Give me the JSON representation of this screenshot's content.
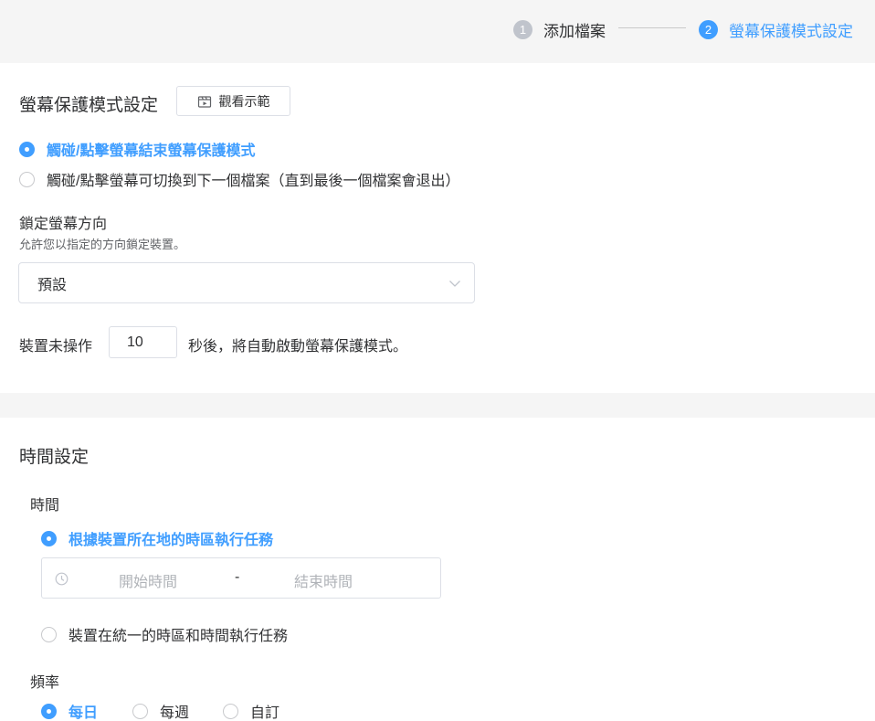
{
  "steps": [
    {
      "num": "1",
      "label": "添加檔案",
      "state": "done"
    },
    {
      "num": "2",
      "label": "螢幕保護模式設定",
      "state": "active"
    }
  ],
  "screensaver": {
    "title": "螢幕保護模式設定",
    "demo_button": "觀看示範",
    "options": [
      {
        "label": "觸碰/點擊螢幕結束螢幕保護模式",
        "selected": true
      },
      {
        "label": "觸碰/點擊螢幕可切換到下一個檔案（直到最後一個檔案會退出）",
        "selected": false
      }
    ],
    "lock": {
      "title": "鎖定螢幕方向",
      "subtitle": "允許您以指定的方向鎖定裝置。",
      "selected": "預設"
    },
    "idle": {
      "prefix": "裝置未操作",
      "value": "10",
      "suffix": "秒後，將自動啟動螢幕保護模式。"
    }
  },
  "time_settings": {
    "title": "時間設定",
    "time_label": "時間",
    "timezone_options": [
      {
        "label": "根據裝置所在地的時區執行任務",
        "selected": true
      },
      {
        "label": "裝置在統一的時區和時間執行任務",
        "selected": false
      }
    ],
    "range": {
      "start_placeholder": "開始時間",
      "separator": "-",
      "end_placeholder": "結束時間"
    },
    "frequency_label": "頻率",
    "frequency_options": [
      {
        "label": "每日",
        "selected": true
      },
      {
        "label": "每週",
        "selected": false
      },
      {
        "label": "自訂",
        "selected": false
      }
    ]
  },
  "colors": {
    "accent": "#409eff",
    "text": "#303133",
    "border": "#dcdfe6",
    "background_gray": "#f5f5f5"
  },
  "icons": [
    "video-clip-icon",
    "chevron-down-icon",
    "clock-icon"
  ]
}
